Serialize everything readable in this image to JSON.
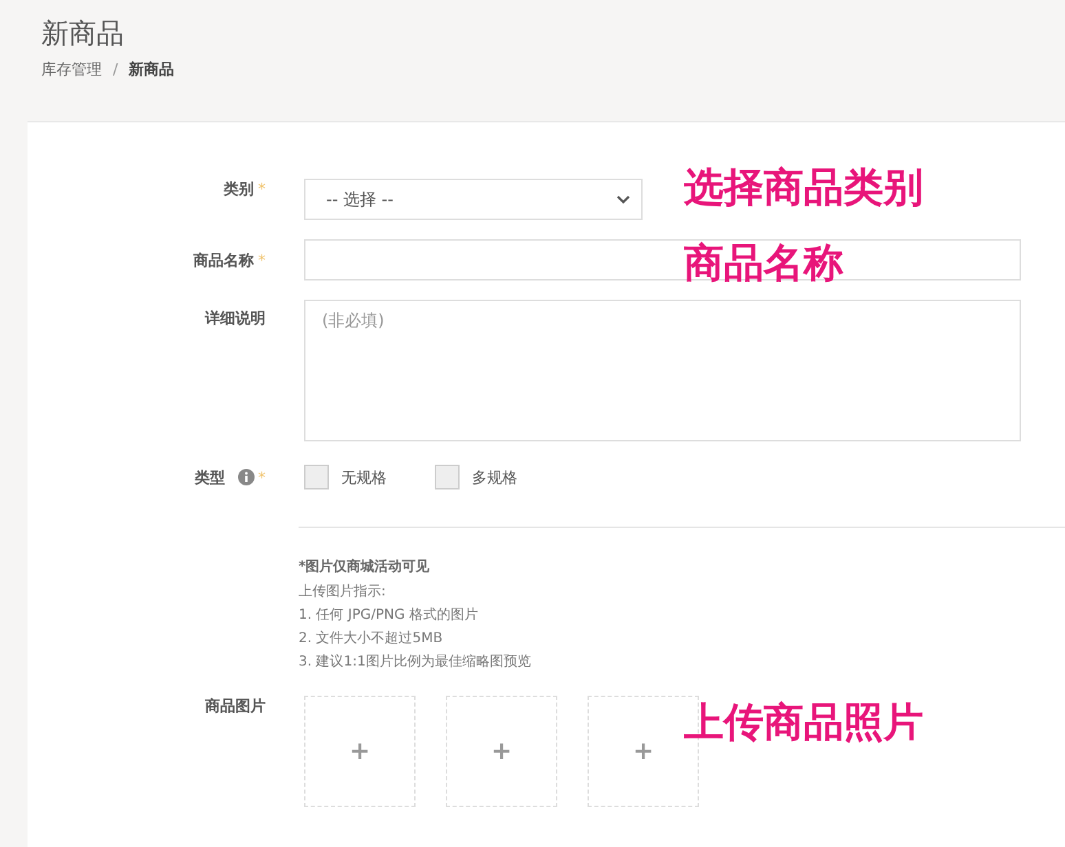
{
  "page": {
    "title": "新商品"
  },
  "breadcrumb": [
    {
      "label": "库存管理",
      "current": false
    },
    {
      "label": "新商品",
      "current": true
    }
  ],
  "breadcrumb_separator": "/",
  "form": {
    "category": {
      "label": "类别",
      "required_mark": "*",
      "value": "-- 选择 --"
    },
    "name": {
      "label": "商品名称",
      "required_mark": "*"
    },
    "description": {
      "label": "详细说明",
      "placeholder": "(非必填)"
    },
    "type": {
      "label": "类型",
      "required_mark": "*",
      "options": [
        {
          "label": "无规格",
          "checked": false
        },
        {
          "label": "多规格",
          "checked": false
        }
      ]
    },
    "image_note": {
      "title": "*图片仅商城活动可见",
      "lines": [
        "上传图片指示:",
        "1. 任何 JPG/PNG 格式的图片",
        "2. 文件大小不超过5MB",
        "3. 建议1:1图片比例为最佳缩略图预览"
      ]
    },
    "images": {
      "label": "商品图片",
      "slots": [
        "+",
        "+",
        "+"
      ]
    }
  },
  "annotations": [
    "选择商品类别",
    "商品名称",
    "上传商品照片"
  ]
}
